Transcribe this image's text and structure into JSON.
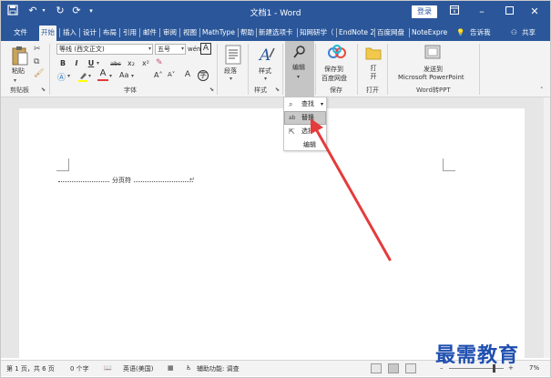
{
  "titlebar": {
    "doc_title": "文档1 - Word",
    "login_label": "登录"
  },
  "tabs": [
    "文件",
    "开始",
    "插入",
    "设计",
    "布局",
    "引用",
    "邮件",
    "审阅",
    "视图",
    "MathType",
    "帮助",
    "新建选项卡",
    "知网研学（",
    "EndNote 2",
    "百度网盘",
    "NoteExpre",
    "告诉我",
    "共享"
  ],
  "ribbon": {
    "clipboard": {
      "paste_label": "粘贴",
      "group_label": "剪贴板"
    },
    "font": {
      "font_name": "等线 (西文正文)",
      "font_size": "五号",
      "wen_glyph": "wén",
      "a_glyph": "A",
      "bold": "B",
      "italic": "I",
      "underline": "U",
      "strike": "abc",
      "sub": "x₂",
      "sup": "x²",
      "group_label": "字体"
    },
    "paragraph": {
      "label": "段落"
    },
    "styles": {
      "label": "样式",
      "group_label": "样式"
    },
    "editing": {
      "label": "编辑"
    },
    "save": {
      "label_line1": "保存到",
      "label_line2": "百度网盘",
      "group_label": "保存"
    },
    "open": {
      "label": "打开",
      "group_label": "打开"
    },
    "ppt": {
      "label_line1": "发送到",
      "label_line2": "Microsoft PowerPoint",
      "group_label": "Word转PPT"
    }
  },
  "dropdown": {
    "find": "查找",
    "replace": "替换",
    "select": "选择",
    "edit": "编辑"
  },
  "document": {
    "page_break_label": "分页符"
  },
  "statusbar": {
    "page_info": "第 1 页，共 6 页",
    "word_count": "0 个字",
    "language": "英语(美国)",
    "accessibility": "辅助功能: 调查",
    "zoom": "7%"
  },
  "watermark": "最需教育",
  "colors": {
    "title_blue": "#2b579a",
    "arrow_red": "#e53b3b",
    "watermark_blue": "#1f4fb0"
  }
}
